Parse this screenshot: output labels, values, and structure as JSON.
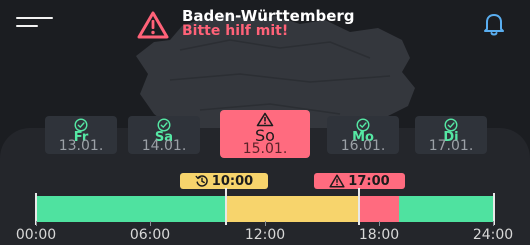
{
  "header": {
    "region": "Baden-Württemberg",
    "alert_text": "Bitte hilf mit!",
    "icons": {
      "menu": "menu-icon",
      "warning": "warning-triangle-icon",
      "notifications": "bell-icon"
    }
  },
  "days": [
    {
      "name": "Fr",
      "date": "13.01.",
      "status": "ok",
      "selected": false
    },
    {
      "name": "Sa",
      "date": "14.01.",
      "status": "ok",
      "selected": false
    },
    {
      "name": "So",
      "date": "15.01.",
      "status": "warning",
      "selected": true
    },
    {
      "name": "Mo",
      "date": "16.01.",
      "status": "ok",
      "selected": false
    },
    {
      "name": "Di",
      "date": "17.01.",
      "status": "ok",
      "selected": false
    }
  ],
  "badges": {
    "start_time": "10:00",
    "alert_time": "17:00"
  },
  "timeline": {
    "labels": [
      "00:00",
      "06:00",
      "12:00",
      "18:00",
      "24:00"
    ],
    "segments": [
      {
        "from": "00:00",
        "to": "10:00",
        "status": "green"
      },
      {
        "from": "10:00",
        "to": "17:00",
        "status": "yellow"
      },
      {
        "from": "17:00",
        "to": "19:00",
        "status": "red"
      },
      {
        "from": "19:00",
        "to": "24:00",
        "status": "green"
      }
    ]
  },
  "colors": {
    "background": "#1b1d21",
    "panel": "#24262b",
    "card": "#2f333a",
    "green": "#4fe2a0",
    "yellow": "#f7d46c",
    "red": "#ff6b7f",
    "alert_text": "#ff6278"
  }
}
